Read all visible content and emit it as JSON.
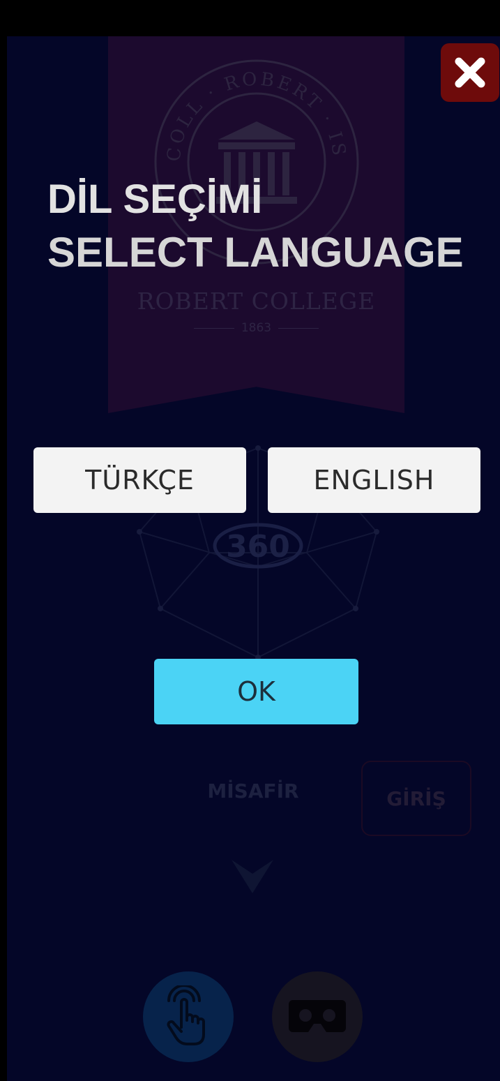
{
  "dialog": {
    "title_tr": "DİL SEÇİMİ",
    "title_en": "SELECT LANGUAGE",
    "turkish_label": "TÜRKÇE",
    "english_label": "ENGLISH",
    "ok_label": "OK"
  },
  "background": {
    "seal_text_top": "COLL · ROBERT · ISTANBUL",
    "college_name": "ROBERT COLLEGE",
    "year": "1863",
    "badge_360": "360",
    "guest_label": "MİSAFİR",
    "login_label": "GİRİŞ"
  },
  "icons": {
    "close": "close-icon",
    "touch": "hand-touch-icon",
    "vr": "vr-headset-icon",
    "down": "chevron-down-icon"
  },
  "colors": {
    "background": "#040628",
    "close_button": "#6e0b0b",
    "ok_button": "#4bd3f5",
    "language_button": "#f3f3f3"
  }
}
